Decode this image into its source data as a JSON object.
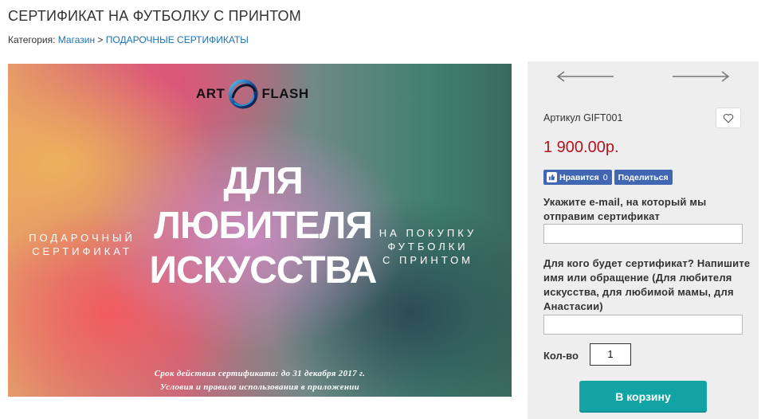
{
  "header": {
    "title": "СЕРТИФИКАТ НА ФУТБОЛКУ С ПРИНТОМ",
    "breadcrumb": {
      "prefix": "Категория:",
      "link1": "Магазин",
      "separator": ">",
      "link2": "ПОДАРОЧНЫЕ СЕРТИФИКАТЫ"
    }
  },
  "banner": {
    "logo_left": "ART",
    "logo_right": "FLASH",
    "headline_lines": [
      "ДЛЯ",
      "ЛЮБИТЕЛЯ",
      "ИСКУССТВА"
    ],
    "left_lines": [
      "ПОДАРОЧНЫЙ",
      "СЕРТИФИКАТ"
    ],
    "right_lines": [
      "НА ПОКУПКУ",
      "ФУТБОЛКИ",
      "С ПРИНТОМ"
    ],
    "footer_line1": "Срок действия сертификата: до 31 декабря 2017 г.",
    "footer_line2": "Условия и правила использования в приложении"
  },
  "product": {
    "sku": "Артикул GIFT001",
    "price": "1 900.00р.",
    "like_label": "Нравится",
    "like_count": "0",
    "share_label": "Поделиться",
    "email_label": "Укажите e-mail, на который мы отправим сертификат",
    "email_value": "",
    "recipient_label": "Для кого будет сертификат? Напишите имя или обращение (Для любителя искусства, для любимой мамы, для Анастасии)",
    "recipient_value": "",
    "qty_label": "Кол-во",
    "qty_value": "1",
    "cart_button": "В корзину"
  },
  "colors": {
    "accent": "#12a3a5",
    "price": "#b0151f",
    "link": "#1a73b5",
    "facebook": "#4267b2",
    "panel_bg": "#eeeeee"
  },
  "icons": [
    "arrow-left-icon",
    "arrow-right-icon",
    "heart-icon",
    "thumbs-up-icon"
  ]
}
